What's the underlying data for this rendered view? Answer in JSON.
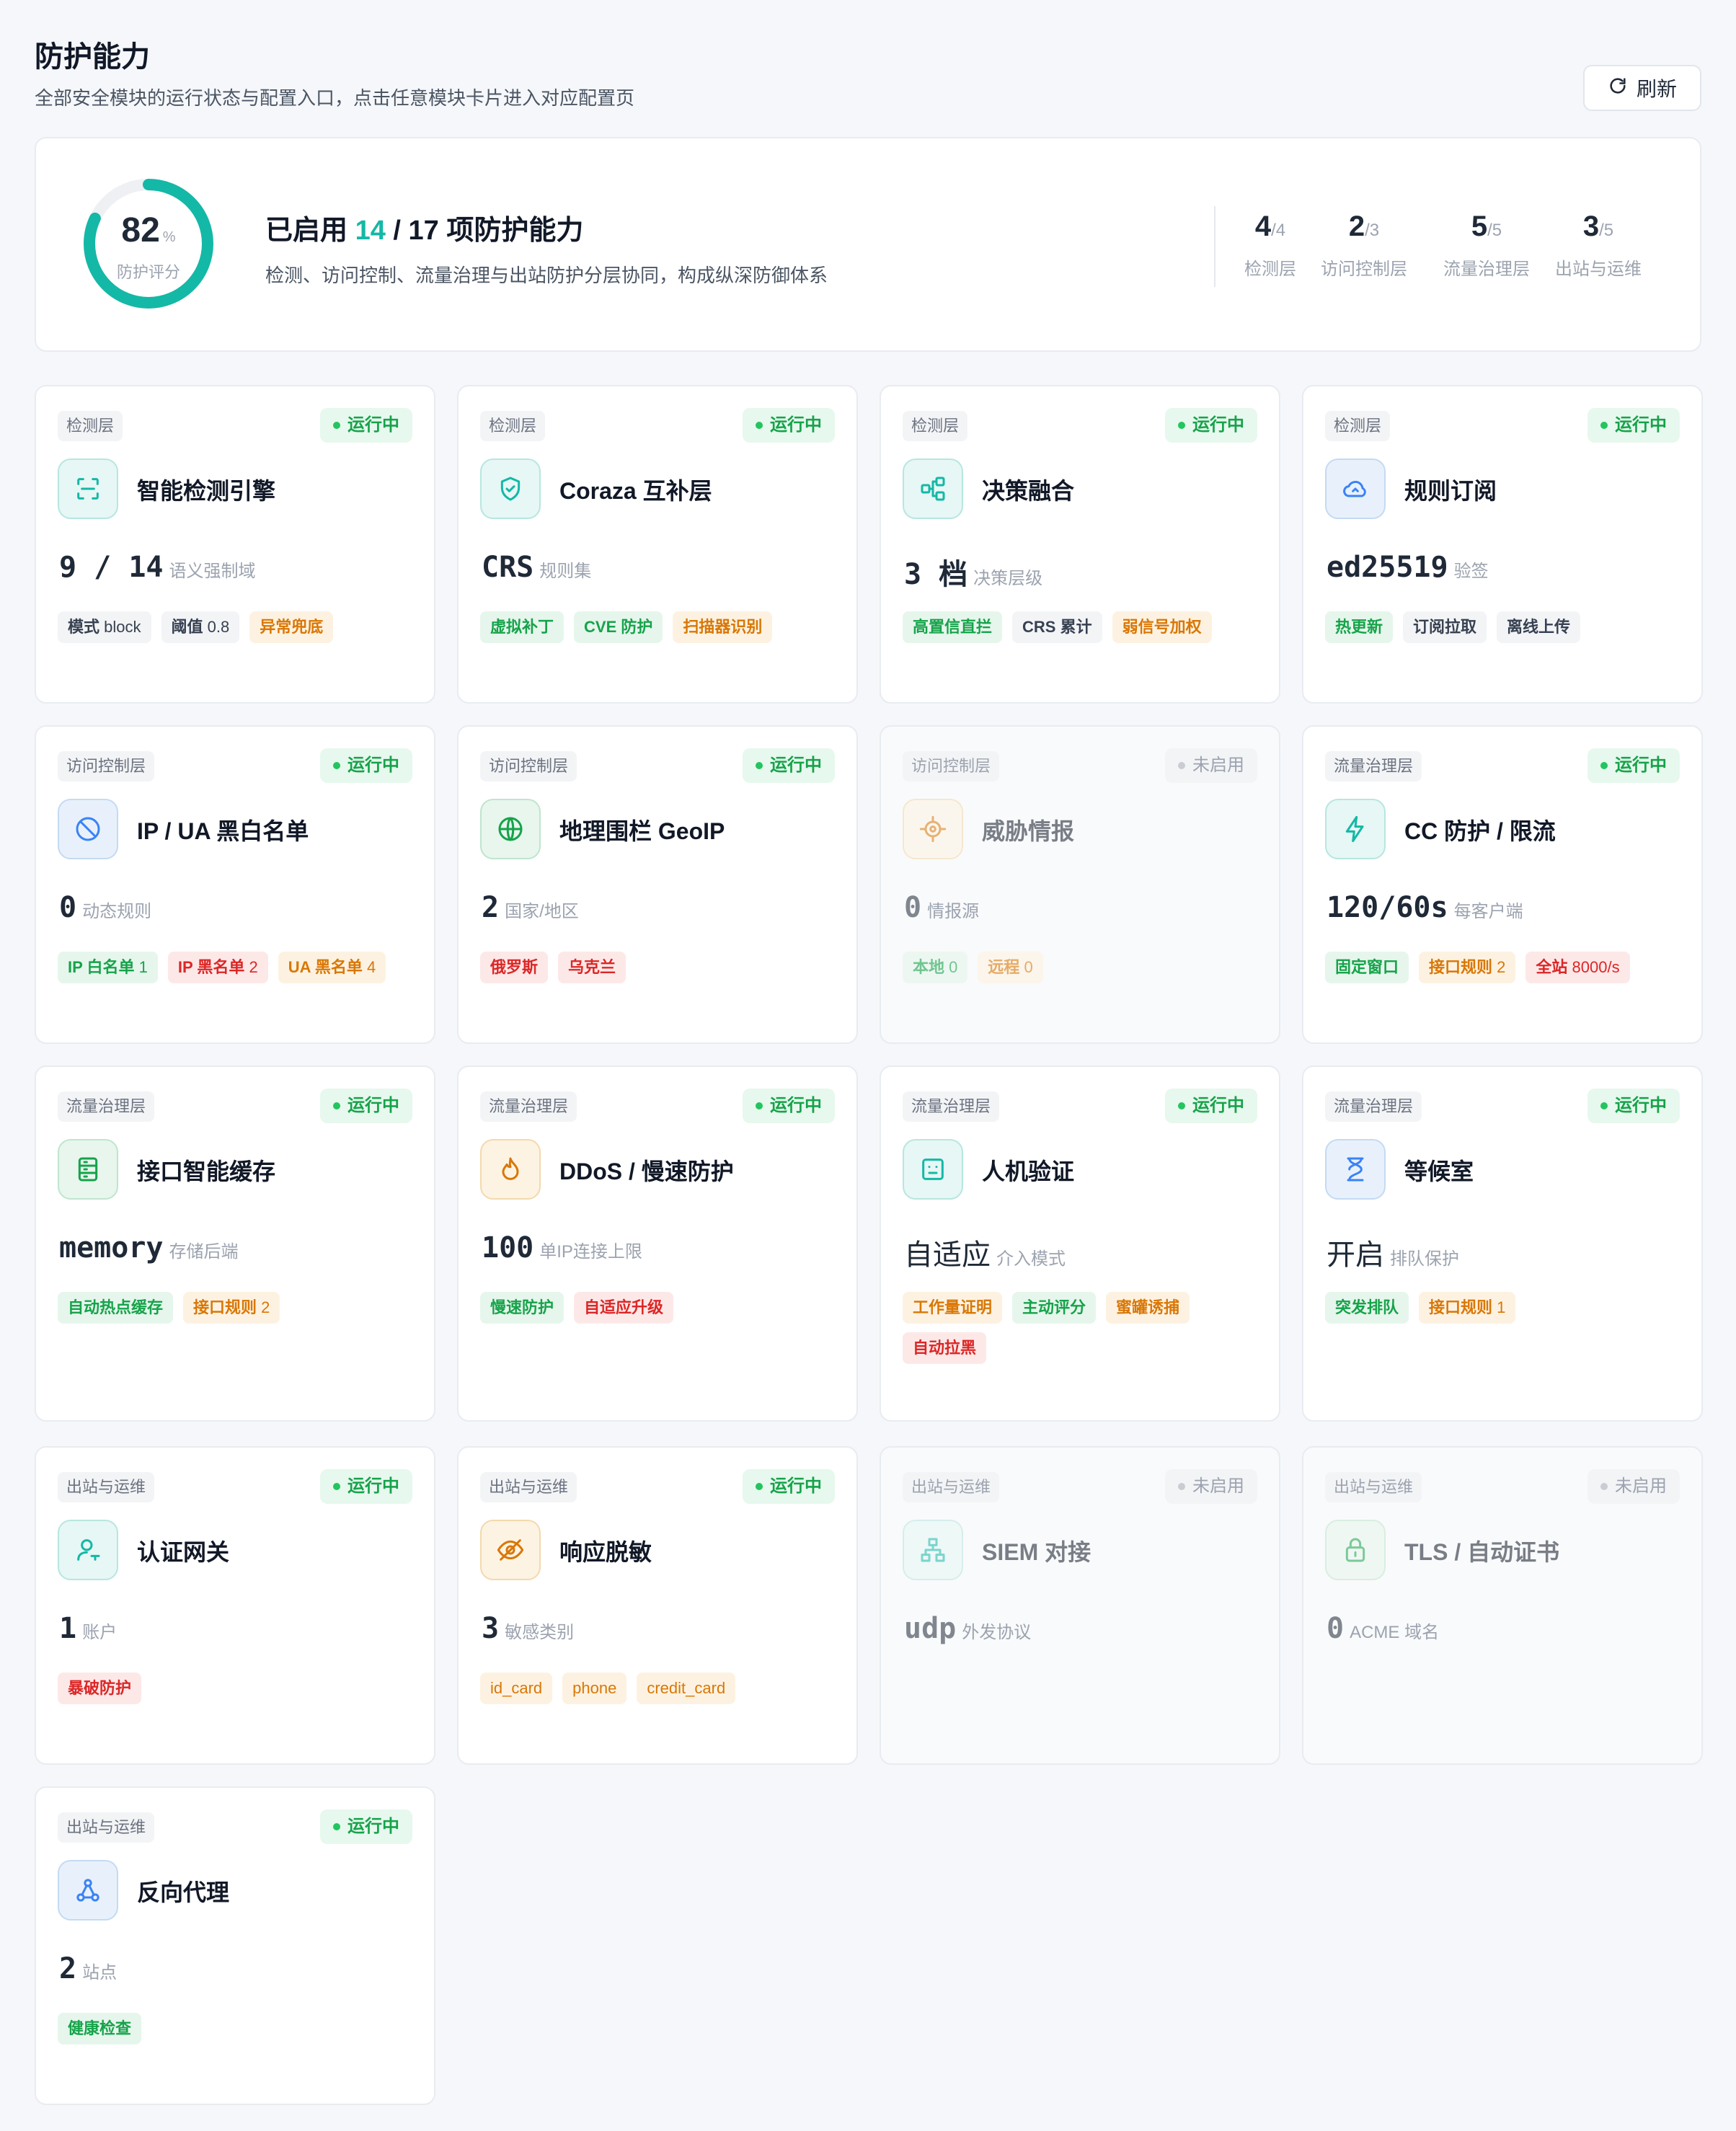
{
  "header": {
    "title": "防护能力",
    "subtitle": "全部安全模块的运行状态与配置入口，点击任意模块卡片进入对应配置页",
    "refresh_label": "刷新"
  },
  "summary": {
    "score": "82",
    "score_unit": "%",
    "score_fraction": 0.82,
    "score_label": "防护评分",
    "title_prefix": "已启用",
    "enabled": "14",
    "total_text": "/ 17 项防护能力",
    "description": "检测、访问控制、流量治理与出站防护分层协同，构成纵深防御体系",
    "layers": [
      {
        "num": "4",
        "den": "/4",
        "label": "检测层"
      },
      {
        "num": "2",
        "den": "/3",
        "label": "访问控制层"
      },
      {
        "num": "5",
        "den": "/5",
        "label": "流量治理层"
      },
      {
        "num": "3",
        "den": "/5",
        "label": "出站与运维"
      }
    ]
  },
  "status_labels": {
    "on": "运行中",
    "off": "未启用"
  },
  "cards": [
    {
      "layer": "检测层",
      "status": "运行中",
      "name": "智能检测引擎",
      "metric": "9 / 14",
      "unit": "语义强制域",
      "tags": [
        {
          "k": "模式",
          "v": " block"
        },
        {
          "k": "阈值",
          "v": " 0.8"
        },
        {
          "k": "异常兜底",
          "v": ""
        }
      ]
    },
    {
      "layer": "检测层",
      "status": "运行中",
      "name": "Coraza 互补层",
      "metric": "CRS",
      "unit": "规则集",
      "tags": [
        {
          "k": "虚拟补丁",
          "v": ""
        },
        {
          "k": "CVE 防护",
          "v": ""
        },
        {
          "k": "扫描器识别",
          "v": ""
        }
      ]
    },
    {
      "layer": "检测层",
      "status": "运行中",
      "name": "决策融合",
      "metric": "3 档",
      "unit": "决策层级",
      "tags": [
        {
          "k": "高置信直拦",
          "v": ""
        },
        {
          "k": "CRS 累计",
          "v": ""
        },
        {
          "k": "弱信号加权",
          "v": ""
        }
      ]
    },
    {
      "layer": "检测层",
      "status": "运行中",
      "name": "规则订阅",
      "metric": "ed25519",
      "unit": "验签",
      "tags": [
        {
          "k": "热更新",
          "v": ""
        },
        {
          "k": "订阅拉取",
          "v": ""
        },
        {
          "k": "离线上传",
          "v": ""
        }
      ]
    },
    {
      "layer": "访问控制层",
      "status": "运行中",
      "name": "IP / UA 黑白名单",
      "metric": "0",
      "unit": "动态规则",
      "tags": [
        {
          "k": "IP 白名单",
          "v": " 1"
        },
        {
          "k": "IP 黑名单",
          "v": " 2"
        },
        {
          "k": "UA 黑名单",
          "v": " 4"
        }
      ]
    },
    {
      "layer": "访问控制层",
      "status": "运行中",
      "name": "地理围栏 GeoIP",
      "metric": "2",
      "unit": "国家/地区",
      "tags": [
        {
          "k": "俄罗斯",
          "v": ""
        },
        {
          "k": "乌克兰",
          "v": ""
        }
      ]
    },
    {
      "layer": "访问控制层",
      "status": "未启用",
      "name": "威胁情报",
      "metric": "0",
      "unit": "情报源",
      "tags": [
        {
          "k": "本地",
          "v": " 0"
        },
        {
          "k": "远程",
          "v": " 0"
        }
      ]
    },
    {
      "layer": "流量治理层",
      "status": "运行中",
      "name": "CC 防护 / 限流",
      "metric": "120/60s",
      "unit": "每客户端",
      "tags": [
        {
          "k": "固定窗口",
          "v": ""
        },
        {
          "k": "接口规则",
          "v": " 2"
        },
        {
          "k": "全站",
          "v": " 8000/s"
        }
      ]
    },
    {
      "layer": "流量治理层",
      "status": "运行中",
      "name": "接口智能缓存",
      "metric": "memory",
      "unit": "存储后端",
      "tags": [
        {
          "k": "自动热点缓存",
          "v": ""
        },
        {
          "k": "接口规则",
          "v": " 2"
        }
      ]
    },
    {
      "layer": "流量治理层",
      "status": "运行中",
      "name": "DDoS / 慢速防护",
      "metric": "100",
      "unit": "单IP连接上限",
      "tags": [
        {
          "k": "慢速防护",
          "v": ""
        },
        {
          "k": "自适应升级",
          "v": ""
        }
      ]
    },
    {
      "layer": "流量治理层",
      "status": "运行中",
      "name": "人机验证",
      "metric": "自适应",
      "unit": "介入模式",
      "tags": [
        {
          "k": "工作量证明",
          "v": ""
        },
        {
          "k": "主动评分",
          "v": ""
        },
        {
          "k": "蜜罐诱捕",
          "v": ""
        },
        {
          "k": "自动拉黑",
          "v": ""
        }
      ]
    },
    {
      "layer": "流量治理层",
      "status": "运行中",
      "name": "等候室",
      "metric": "开启",
      "unit": "排队保护",
      "tags": [
        {
          "k": "突发排队",
          "v": ""
        },
        {
          "k": "接口规则",
          "v": " 1"
        }
      ]
    },
    {
      "layer": "出站与运维",
      "status": "运行中",
      "name": "认证网关",
      "metric": "1",
      "unit": "账户",
      "tags": [
        {
          "k": "暴破防护",
          "v": ""
        }
      ]
    },
    {
      "layer": "出站与运维",
      "status": "运行中",
      "name": "响应脱敏",
      "metric": "3",
      "unit": "敏感类别",
      "tags": [
        {
          "k": "",
          "v": "id_card"
        },
        {
          "k": "",
          "v": "phone"
        },
        {
          "k": "",
          "v": "credit_card"
        }
      ]
    },
    {
      "layer": "出站与运维",
      "status": "未启用",
      "name": "SIEM 对接",
      "metric": "udp",
      "unit": "外发协议",
      "tags": []
    },
    {
      "layer": "出站与运维",
      "status": "未启用",
      "name": "TLS / 自动证书",
      "metric": "0",
      "unit": "ACME 域名",
      "tags": []
    },
    {
      "layer": "出站与运维",
      "status": "运行中",
      "name": "反向代理",
      "metric": "2",
      "unit": "站点",
      "tags": [
        {
          "k": "健康检查",
          "v": ""
        }
      ]
    }
  ],
  "icons": [
    "scan-icon",
    "shield-check-icon",
    "flow-icon",
    "cloud-sync-icon",
    "ban-icon",
    "globe-icon",
    "target-icon",
    "bolt-icon",
    "database-icon",
    "flame-icon",
    "robot-face-icon",
    "hourglass-icon",
    "user-key-icon",
    "eye-off-icon",
    "network-icon",
    "lock-icon",
    "share-nodes-icon"
  ],
  "colors": {
    "accent": "#14b8a6",
    "running": "#16a34a",
    "warning": "#d97706",
    "danger": "#dc2626"
  }
}
